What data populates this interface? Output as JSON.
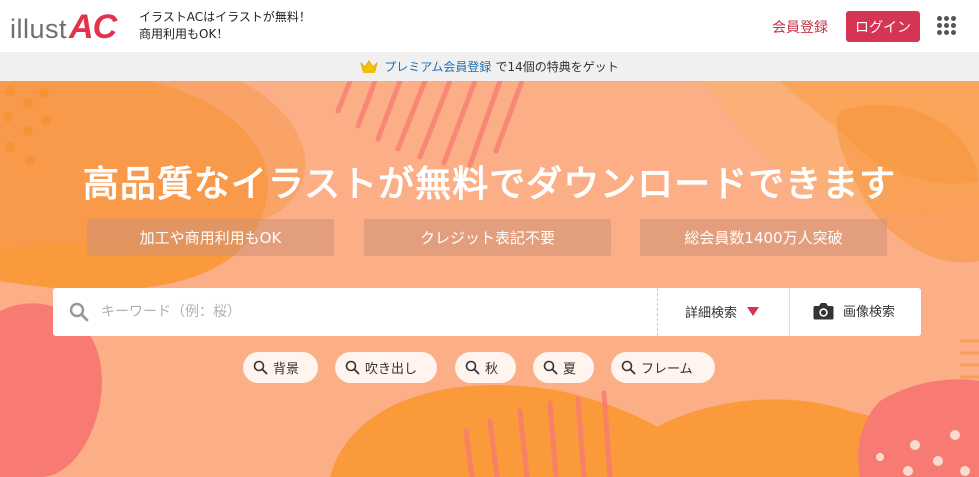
{
  "header": {
    "logo_text": "illust",
    "logo_accent": "AC",
    "tagline_line1": "イラストACはイラストが無料！",
    "tagline_line2": "商用利用もOK！",
    "register_label": "会員登録",
    "login_label": "ログイン",
    "apps_icon": "grid-icon"
  },
  "premium_bar": {
    "crown_icon": "crown-icon",
    "link_label": "プレミアム会員登録",
    "suffix": "で14個の特典をゲット"
  },
  "hero": {
    "title": "高品質なイラストが無料でダウンロードできます",
    "features": [
      "加工や商用利用もOK",
      "クレジット表記不要",
      "総会員数1400万人突破"
    ],
    "search": {
      "placeholder": "キーワード（例：桜）",
      "value": "",
      "advanced_label": "詳細検索",
      "image_search_label": "画像検索"
    },
    "tags": [
      "背景",
      "吹き出し",
      "秋",
      "夏",
      "フレーム"
    ]
  },
  "colors": {
    "brand_red": "#d63454",
    "hero_bg": "#fcae86",
    "link_blue": "#1f6fb2"
  }
}
